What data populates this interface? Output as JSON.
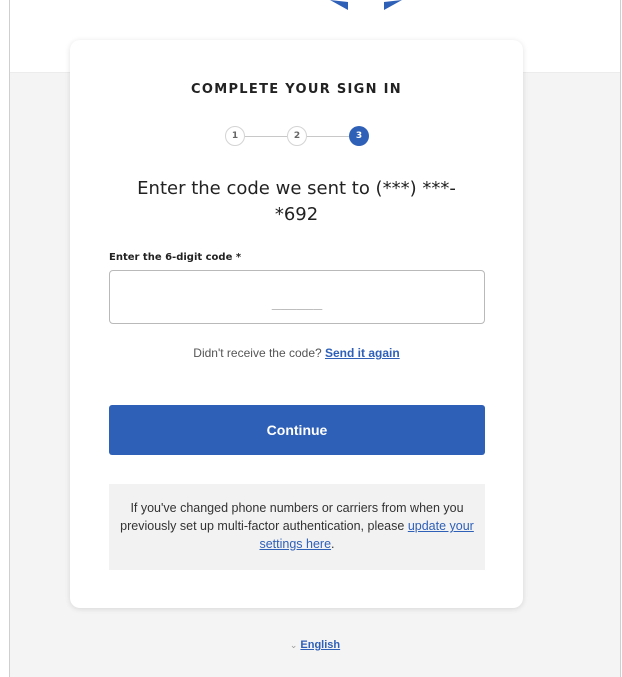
{
  "card": {
    "title": "COMPLETE YOUR SIGN IN",
    "steps": [
      {
        "label": "1",
        "state": "done"
      },
      {
        "label": "2",
        "state": "done"
      },
      {
        "label": "3",
        "state": "active"
      }
    ],
    "heading_line1": "Enter the code we sent to (***) ***-",
    "heading_line2": "*692",
    "code_label": "Enter the 6-digit code *",
    "code_value": "",
    "code_placeholder": "______",
    "resend_prompt": "Didn't receive the code? ",
    "resend_link": "Send it again",
    "continue_label": "Continue",
    "info_text_1": "If you've changed phone numbers or carriers from when you previously set up multi-factor authentication, please ",
    "info_link": "update your settings here",
    "info_text_2": "."
  },
  "footer": {
    "language_icon": "chevron-down-icon",
    "language_label": "English"
  },
  "colors": {
    "accent": "#2f60b7",
    "background": "#f4f4f4",
    "card": "#ffffff",
    "info_box": "#f2f2f2"
  }
}
